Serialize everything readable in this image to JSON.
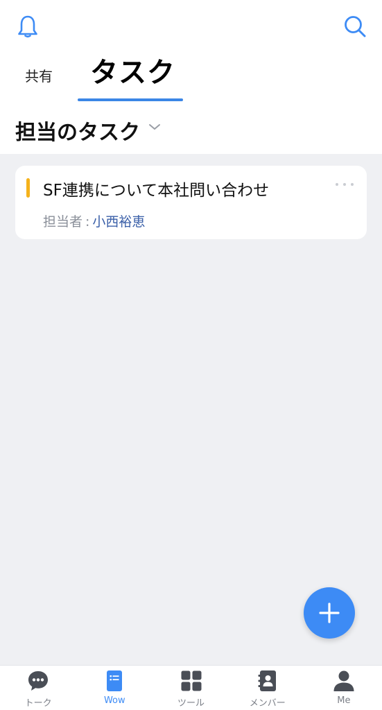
{
  "header": {
    "tabs": [
      {
        "label": "共有"
      },
      {
        "label": "タスク",
        "active": true
      }
    ]
  },
  "section": {
    "title": "担当のタスク"
  },
  "tasks": [
    {
      "title": "SF連携について本社問い合わせ",
      "assignee_label": "担当者",
      "assignee_sep": ":",
      "assignee": "小西裕恵",
      "accent_color": "#f5b21b"
    }
  ],
  "nav": {
    "items": [
      {
        "label": "トーク",
        "icon": "chat-bubble-icon"
      },
      {
        "label": "Wow",
        "icon": "wow-document-icon",
        "active": true
      },
      {
        "label": "ツール",
        "icon": "grid-tools-icon"
      },
      {
        "label": "メンバー",
        "icon": "contacts-icon"
      },
      {
        "label": "Me",
        "icon": "person-icon"
      }
    ]
  },
  "colors": {
    "accent": "#3d8bf5",
    "background": "#eff0f3",
    "task_accent": "#f5b21b",
    "assignee_name": "#3a5fa8"
  }
}
